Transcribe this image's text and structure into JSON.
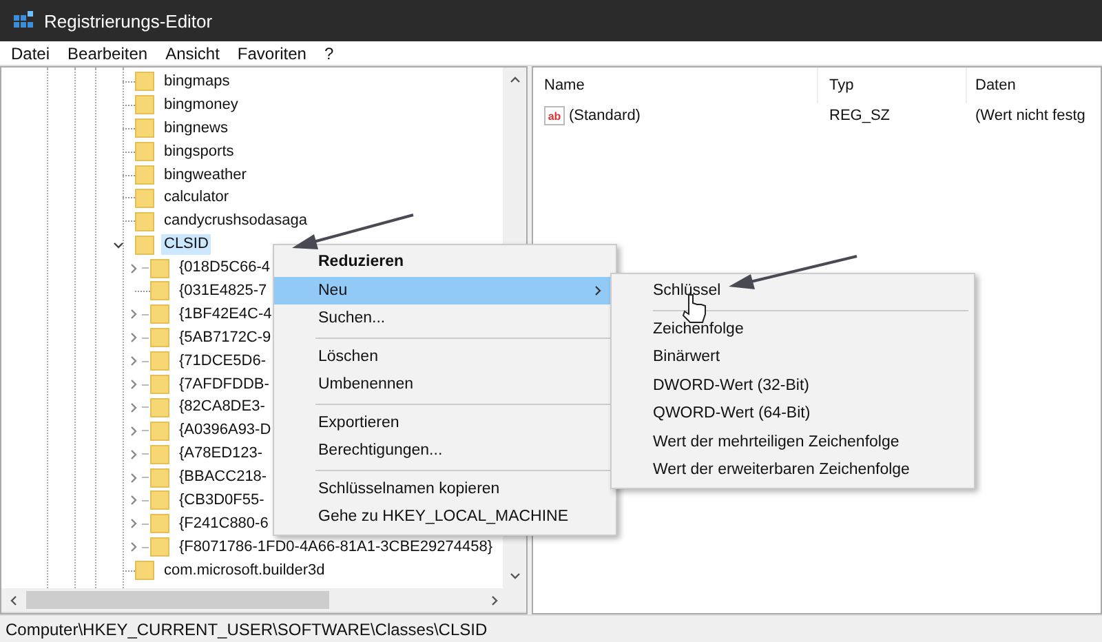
{
  "window": {
    "title": "Registrierungs-Editor"
  },
  "menu_bar": [
    "Datei",
    "Bearbeiten",
    "Ansicht",
    "Favoriten",
    "?"
  ],
  "tree": [
    {
      "label": "bingmaps",
      "selected": false
    },
    {
      "label": "bingmoney",
      "selected": false
    },
    {
      "label": "bingnews",
      "selected": false
    },
    {
      "label": "bingsports",
      "selected": false
    },
    {
      "label": "bingweather",
      "selected": false
    },
    {
      "label": "calculator",
      "selected": false
    },
    {
      "label": "candycrushsodasaga",
      "selected": false
    },
    {
      "label": "CLSID",
      "selected": true,
      "expanded": true,
      "children": [
        {
          "label": "{018D5C66-4",
          "expandable": true
        },
        {
          "label": "{031E4825-7",
          "expandable": false
        },
        {
          "label": "{1BF42E4C-4",
          "expandable": true
        },
        {
          "label": "{5AB7172C-9",
          "expandable": true
        },
        {
          "label": "{71DCE5D6-",
          "expandable": true
        },
        {
          "label": "{7AFDFDDB-",
          "expandable": true
        },
        {
          "label": "{82CA8DE3-",
          "expandable": true
        },
        {
          "label": "{A0396A93-D",
          "expandable": true
        },
        {
          "label": "{A78ED123-",
          "expandable": true
        },
        {
          "label": "{BBACC218-",
          "expandable": true
        },
        {
          "label": "{CB3D0F55-",
          "expandable": true
        },
        {
          "label": "{F241C880-6",
          "expandable": true
        },
        {
          "label": "{F8071786-1FD0-4A66-81A1-3CBE29274458}",
          "expandable": true
        }
      ]
    },
    {
      "label": "com.microsoft.builder3d",
      "selected": false
    }
  ],
  "values_table": {
    "columns": [
      "Name",
      "Typ",
      "Daten"
    ],
    "rows": [
      {
        "icon_label": "ab",
        "name": "(Standard)",
        "type": "REG_SZ",
        "data": "(Wert nicht festg"
      }
    ]
  },
  "context_menu": [
    {
      "kind": "header",
      "label": "Reduzieren",
      "selected": false
    },
    {
      "kind": "submenu",
      "label": "Neu",
      "selected": true
    },
    {
      "kind": "item",
      "label": "Suchen...",
      "selected": false
    },
    {
      "kind": "separator"
    },
    {
      "kind": "item",
      "label": "Löschen",
      "selected": false
    },
    {
      "kind": "item",
      "label": "Umbenennen",
      "selected": false
    },
    {
      "kind": "separator"
    },
    {
      "kind": "item",
      "label": "Exportieren",
      "selected": false
    },
    {
      "kind": "item",
      "label": "Berechtigungen...",
      "selected": false
    },
    {
      "kind": "separator"
    },
    {
      "kind": "item",
      "label": "Schlüsselnamen kopieren",
      "selected": false
    },
    {
      "kind": "item",
      "label": "Gehe zu HKEY_LOCAL_MACHINE",
      "selected": false
    }
  ],
  "submenu": [
    {
      "kind": "item",
      "label": "Schlüssel"
    },
    {
      "kind": "separator"
    },
    {
      "kind": "item",
      "label": "Zeichenfolge"
    },
    {
      "kind": "item",
      "label": "Binärwert"
    },
    {
      "kind": "item",
      "label": "DWORD-Wert (32-Bit)"
    },
    {
      "kind": "item",
      "label": "QWORD-Wert (64-Bit)"
    },
    {
      "kind": "item",
      "label": "Wert der mehrteiligen Zeichenfolge"
    },
    {
      "kind": "item",
      "label": "Wert der erweiterbaren Zeichenfolge"
    }
  ],
  "status_bar": "Computer\\HKEY_CURRENT_USER\\SOFTWARE\\Classes\\CLSID"
}
